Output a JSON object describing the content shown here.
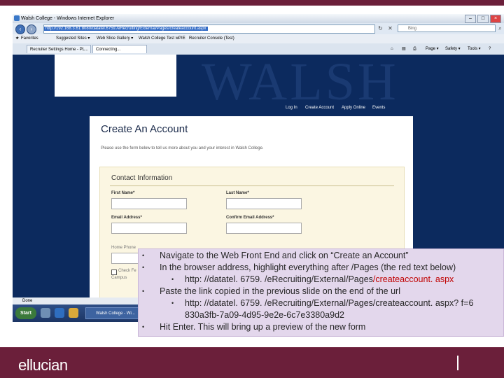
{
  "browser": {
    "title": "Walsh College - Windows Internet Explorer",
    "address": "http://192.168.3.61:8080/datatel.6759./eRecruiting/External/Pages/createaccount.aspx",
    "search_placeholder": "Bing",
    "favorites_label": "Favorites",
    "favorites": [
      "Suggested Sites ▾",
      "Web Slice Gallery ▾",
      "Walsh College Test wPIE",
      "Recruiter Console (Test)"
    ],
    "tabs": [
      "Recruiter Settings Home - PL...",
      "Connecting..."
    ],
    "commands": [
      "Page ▾",
      "Safety ▾",
      "Tools ▾"
    ],
    "status": "Done"
  },
  "site": {
    "nav": [
      "Log In",
      "Create Account",
      "Apply Online",
      "Events"
    ],
    "watermark": "WALSH"
  },
  "form": {
    "title": "Create An Account",
    "intro": "Please use the form below to tell us more about you and your interest in Walsh College.",
    "section": "Contact Information",
    "first_name": "First Name*",
    "last_name": "Last Name*",
    "email": "Email Address*",
    "confirm_email": "Confirm Email Address*",
    "home_phone": "Home Phone",
    "check_label": "Check Fe",
    "campus_label": "Campus"
  },
  "taskbar": {
    "start": "Start",
    "task": "Walsh College - Wi..."
  },
  "instructions": {
    "step1": "Navigate to the Web Front End and click on “Create an Account”",
    "step2": "In the browser address, highlight everything after /Pages (the red text below)",
    "url1_base": "http: //datatel. 6759. /eRecruiting/External/Pages",
    "url1_red": "/createaccount. aspx",
    "step3": "Paste the link copied in the previous slide on the end of the url",
    "url2_line1": "http: //datatel. 6759. /eRecruiting/External/Pages/createaccount. aspx? f=6",
    "url2_line2": "830a3fb-7a09-4d95-9e2e-6c7e3380a9d2",
    "step4": "Hit Enter. This will bring up a preview of the new form"
  },
  "footer": {
    "brand": "ellucian"
  },
  "colors": {
    "accent": "#6b1f3a",
    "page_background": "#0c2a5e",
    "overlay": "#e3d7ec",
    "highlight_red": "#c00000"
  }
}
